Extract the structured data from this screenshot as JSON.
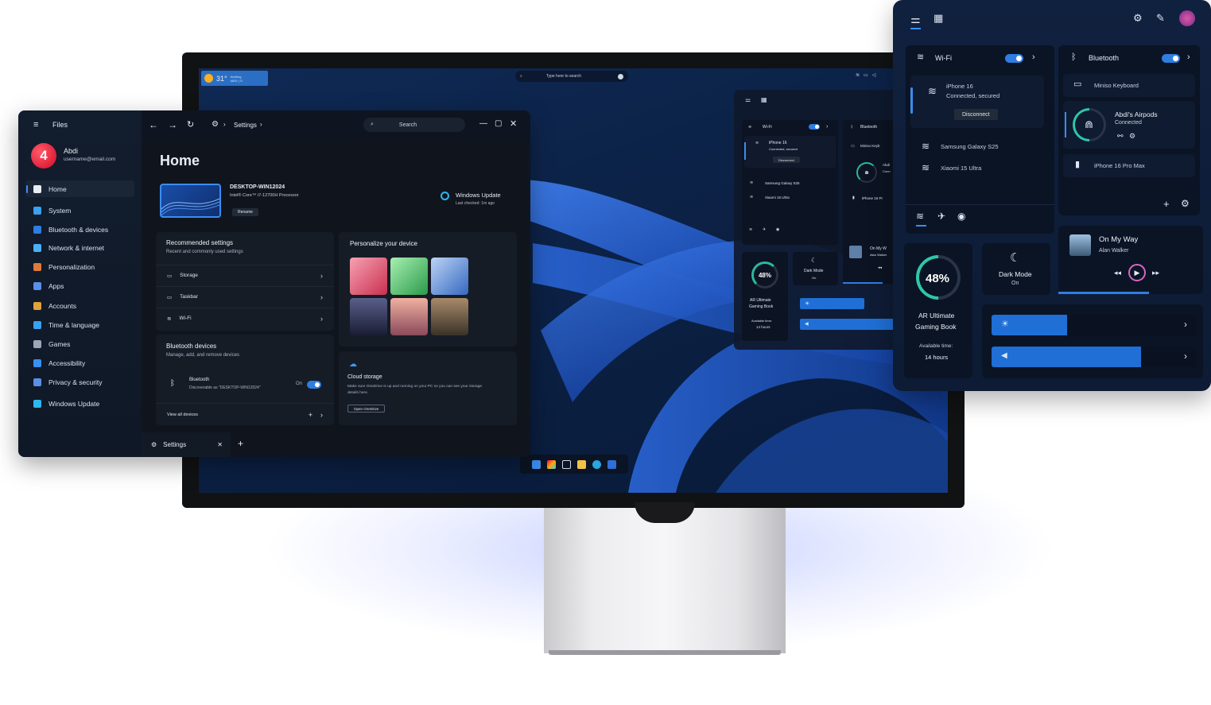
{
  "desktop": {
    "weather": {
      "temp": "31°",
      "line1": "Nothing",
      "line2": "#820 | O"
    },
    "search_placeholder": "Type here to search",
    "mini_panel": {
      "wifi_label": "Wi-Fi",
      "bt_label": "Bluetooth",
      "network1_name": "iPhone 16",
      "network1_status": "Connected, secured",
      "disconnect": "Disconnect",
      "network2": "Samsung Galaxy S25",
      "network3": "Xiaomi 15 Ultra",
      "bt_device1": "Miniso Keyb",
      "bt_device2": "Abdi",
      "bt_device2_sub": "Conn",
      "bt_device3": "iPhone 16 Pr",
      "battery": "48%",
      "device_line1": "AR Ultimate",
      "device_line2": "Gaming Book",
      "avail": "Available time:",
      "avail_val": "14 hours",
      "dark_mode": "Dark Mode",
      "dark_mode_state": "On",
      "song": "On My W",
      "artist": "Alan Walker"
    }
  },
  "window": {
    "app_title": "Files",
    "user_name": "Abdi",
    "user_email": "username@email.com",
    "breadcrumb": "Settings",
    "search_placeholder": "Search",
    "sidebar": [
      {
        "label": "Home",
        "icon": "home-icon",
        "color": "#e8ecf3"
      },
      {
        "label": "System",
        "icon": "system-icon",
        "color": "#3aa0f0"
      },
      {
        "label": "Bluetooth & devices",
        "icon": "bluetooth-icon",
        "color": "#2f7de1"
      },
      {
        "label": "Network & internet",
        "icon": "network-icon",
        "color": "#4ab0f5"
      },
      {
        "label": "Personalization",
        "icon": "personalization-icon",
        "color": "#e07a3a"
      },
      {
        "label": "Apps",
        "icon": "apps-icon",
        "color": "#5b8fe8"
      },
      {
        "label": "Accounts",
        "icon": "accounts-icon",
        "color": "#e0a23a"
      },
      {
        "label": "Time & language",
        "icon": "time-language-icon",
        "color": "#3aa0f0"
      },
      {
        "label": "Games",
        "icon": "games-icon",
        "color": "#9aa6b8"
      },
      {
        "label": "Accessibility",
        "icon": "accessibility-icon",
        "color": "#3a8ff0"
      },
      {
        "label": "Privacy & security",
        "icon": "privacy-icon",
        "color": "#5b8fe8"
      },
      {
        "label": "Windows Update",
        "icon": "windows-update-icon",
        "color": "#2fb6f0"
      }
    ],
    "home_title": "Home",
    "device_name": "DESKTOP-WIN12024",
    "device_cpu": "Intel® Core™ i7-12700H Processor",
    "rename": "Rename",
    "update_title": "Windows Update",
    "update_sub": "Last checked: 1m ago",
    "recommended_title": "Recommended settings",
    "recommended_sub": "Recent and commonly used settings",
    "recommended_rows": [
      "Storage",
      "Taskbar",
      "Wi-Fi"
    ],
    "personalize_title": "Personalize your device",
    "bt_title": "Bluetooth devices",
    "bt_sub": "Manage, add, and remove devices",
    "bt_row_title": "Bluetooth",
    "bt_row_sub": "Discoverable as \"DESKTOP-WIN12024\"",
    "bt_on": "On",
    "view_all": "View all devices",
    "cloud_title": "Cloud storage",
    "cloud_sub_1": "Make sure OneDrive is up and running on your PC so you can see your storage",
    "cloud_sub_2": "details here.",
    "open_onedrive": "Open OneDrive",
    "tab_label": "Settings"
  },
  "quick_panel": {
    "wifi_label": "Wi-Fi",
    "bt_label": "Bluetooth",
    "network1_name": "iPhone 16",
    "network1_status": "Connected, secured",
    "disconnect": "Disconnect",
    "network2": "Samsung Galaxy S25",
    "network3": "Xiaomi 15 Ultra",
    "bt_device1": "Miniso Keyboard",
    "bt_device2": "Abdi's Airpods",
    "bt_device2_status": "Connected",
    "bt_device3": "iPhone 16 Pro Max",
    "battery": "48%",
    "device_line1": "AR Ultimate",
    "device_line2": "Gaming Book",
    "avail": "Available time:",
    "avail_val": "14 hours",
    "dark_mode": "Dark Mode",
    "dark_mode_state": "On",
    "song": "On My Way",
    "artist": "Alan Walker",
    "brightness_level": 0.37,
    "volume_level": 0.73,
    "accent": "#1f6fd6"
  }
}
